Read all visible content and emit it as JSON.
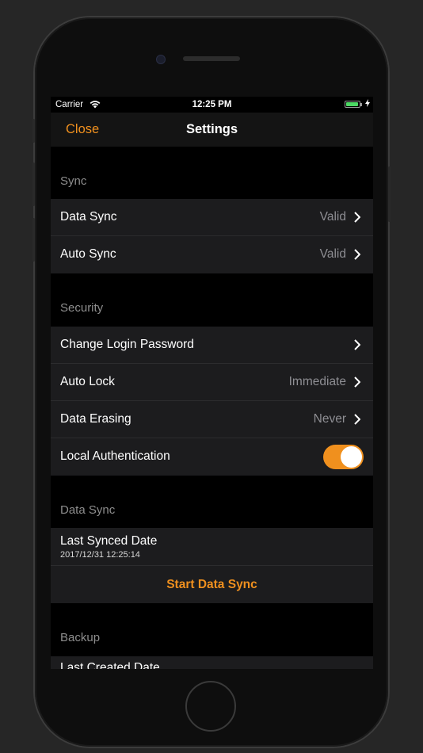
{
  "status_bar": {
    "carrier": "Carrier",
    "time": "12:25 PM",
    "battery_color": "#4cd964"
  },
  "nav": {
    "close_label": "Close",
    "title": "Settings",
    "accent_color": "#f0901e"
  },
  "sections": {
    "sync": {
      "header": "Sync",
      "rows": [
        {
          "label": "Data Sync",
          "value": "Valid"
        },
        {
          "label": "Auto Sync",
          "value": "Valid"
        }
      ]
    },
    "security": {
      "header": "Security",
      "rows": [
        {
          "label": "Change Login Password",
          "value": ""
        },
        {
          "label": "Auto Lock",
          "value": "Immediate"
        },
        {
          "label": "Data Erasing",
          "value": "Never"
        },
        {
          "label": "Local Authentication",
          "toggle_on": true
        }
      ]
    },
    "data_sync": {
      "header": "Data Sync",
      "last_synced_label": "Last Synced Date",
      "last_synced_value": "2017/12/31 12:25:14",
      "action_label": "Start Data Sync"
    },
    "backup": {
      "header": "Backup",
      "first_row_label": "Last Created Date"
    }
  }
}
